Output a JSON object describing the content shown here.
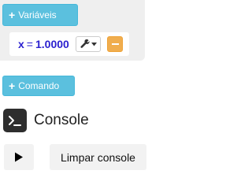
{
  "variables_panel": {
    "add_button_label": "Variáveis",
    "variable": {
      "name": "x",
      "equals": "=",
      "value": "1.0000"
    },
    "tool_icon": "wrench-icon",
    "remove_icon": "minus-icon"
  },
  "command": {
    "add_button_label": "Comando"
  },
  "console": {
    "icon": "terminal-icon",
    "title": "Console",
    "run_icon": "play-icon",
    "clear_button_label": "Limpar console"
  },
  "colors": {
    "info_button": "#5bc0de",
    "warning_button": "#f0ad4e",
    "variable_text": "#2a1fcf",
    "panel_background": "#efefef",
    "console_icon_background": "#2e2e2e"
  }
}
